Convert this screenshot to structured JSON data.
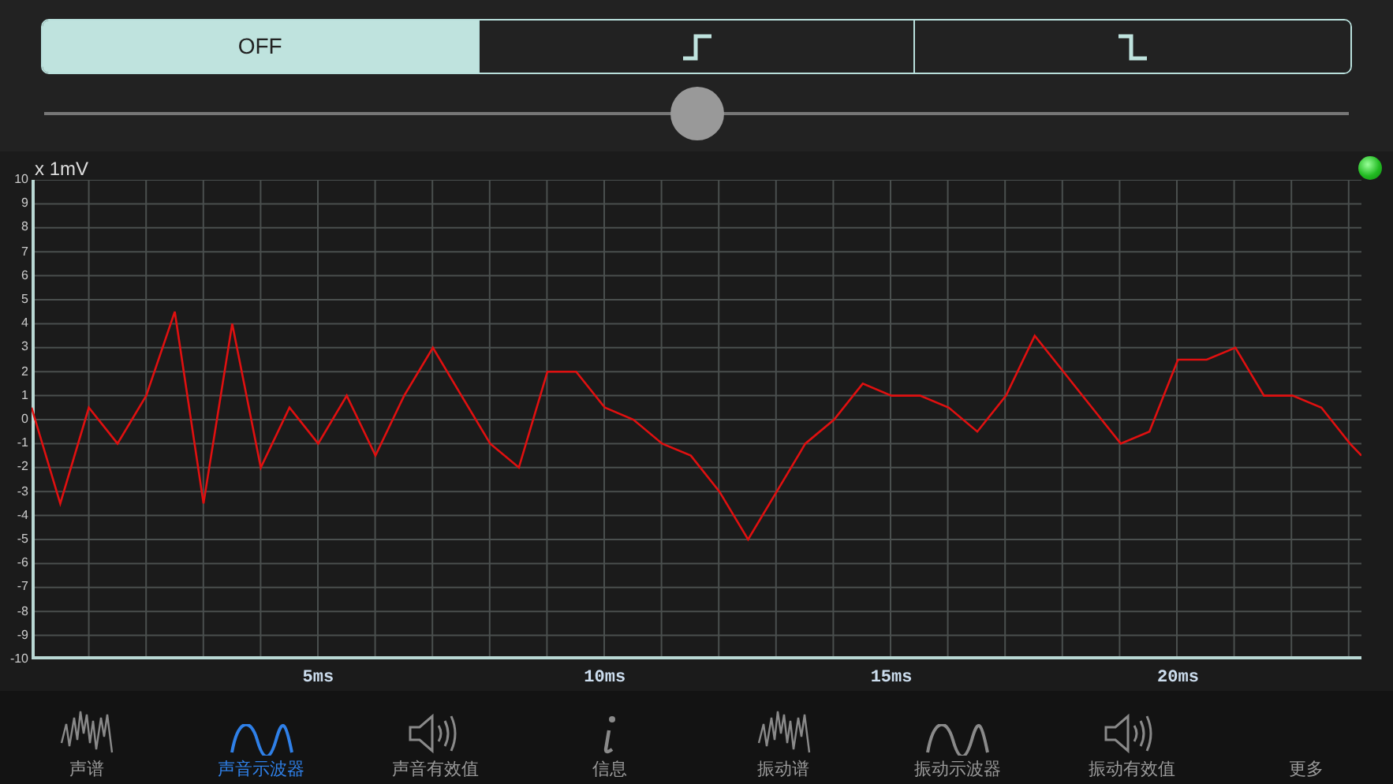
{
  "trigger_modes": [
    {
      "kind": "text",
      "label": "OFF",
      "selected": true
    },
    {
      "kind": "rising-edge",
      "selected": false
    },
    {
      "kind": "falling-edge",
      "selected": false
    }
  ],
  "trigger_slider": {
    "level": 0.5
  },
  "scope": {
    "chart_data": {
      "type": "line",
      "ylabel": "x 1mV",
      "xlim": [
        0,
        23.2
      ],
      "ylim": [
        -10,
        10
      ],
      "x": [
        0,
        0.5,
        1,
        1.5,
        2,
        2.5,
        3,
        3.5,
        4,
        4.5,
        5,
        5.5,
        6,
        6.5,
        7,
        7.5,
        8,
        8.5,
        9,
        9.5,
        10,
        10.5,
        11,
        11.5,
        12,
        12.5,
        13,
        13.5,
        14,
        14.5,
        15,
        15.5,
        16,
        16.5,
        17,
        17.5,
        18,
        18.5,
        19,
        19.5,
        20,
        20.5,
        21,
        21.5,
        22,
        22.5,
        23,
        23.2
      ],
      "grid": true,
      "series": [
        {
          "color": "#e01010",
          "values": [
            0.5,
            -3.5,
            0.5,
            -1,
            1,
            4.5,
            -3.5,
            4,
            -2,
            0.5,
            -1,
            1,
            -1.5,
            1,
            3,
            1,
            -1,
            -2,
            2,
            2,
            0.5,
            0,
            -1,
            -1.5,
            -3,
            -5,
            -3,
            -1,
            0,
            1.5,
            1,
            1,
            0.5,
            -0.5,
            1,
            3.5,
            2,
            0.5,
            -1,
            -0.5,
            2.5,
            2.5,
            3,
            1,
            1,
            0.5,
            -1,
            -1.5
          ]
        }
      ],
      "xticks": [
        {
          "value": 5,
          "label": "5ms"
        },
        {
          "value": 10,
          "label": "10ms"
        },
        {
          "value": 15,
          "label": "15ms"
        },
        {
          "value": 20,
          "label": "20ms"
        }
      ],
      "yticks": [
        10,
        9,
        8,
        7,
        6,
        5,
        4,
        3,
        2,
        1,
        0,
        -1,
        -2,
        -3,
        -4,
        -5,
        -6,
        -7,
        -8,
        -9,
        -10
      ]
    }
  },
  "nav": [
    {
      "kind": "spectrum",
      "label": "声谱",
      "selected": false
    },
    {
      "kind": "wave",
      "label": "声音示波器",
      "selected": true
    },
    {
      "kind": "speaker",
      "label": "声音有效值",
      "selected": false
    },
    {
      "kind": "info",
      "label": "信息",
      "selected": false
    },
    {
      "kind": "spectrum",
      "label": "振动谱",
      "selected": false
    },
    {
      "kind": "wave",
      "label": "振动示波器",
      "selected": false
    },
    {
      "kind": "speaker",
      "label": "振动有效值",
      "selected": false
    },
    {
      "kind": "more",
      "label": "更多",
      "selected": false
    }
  ]
}
